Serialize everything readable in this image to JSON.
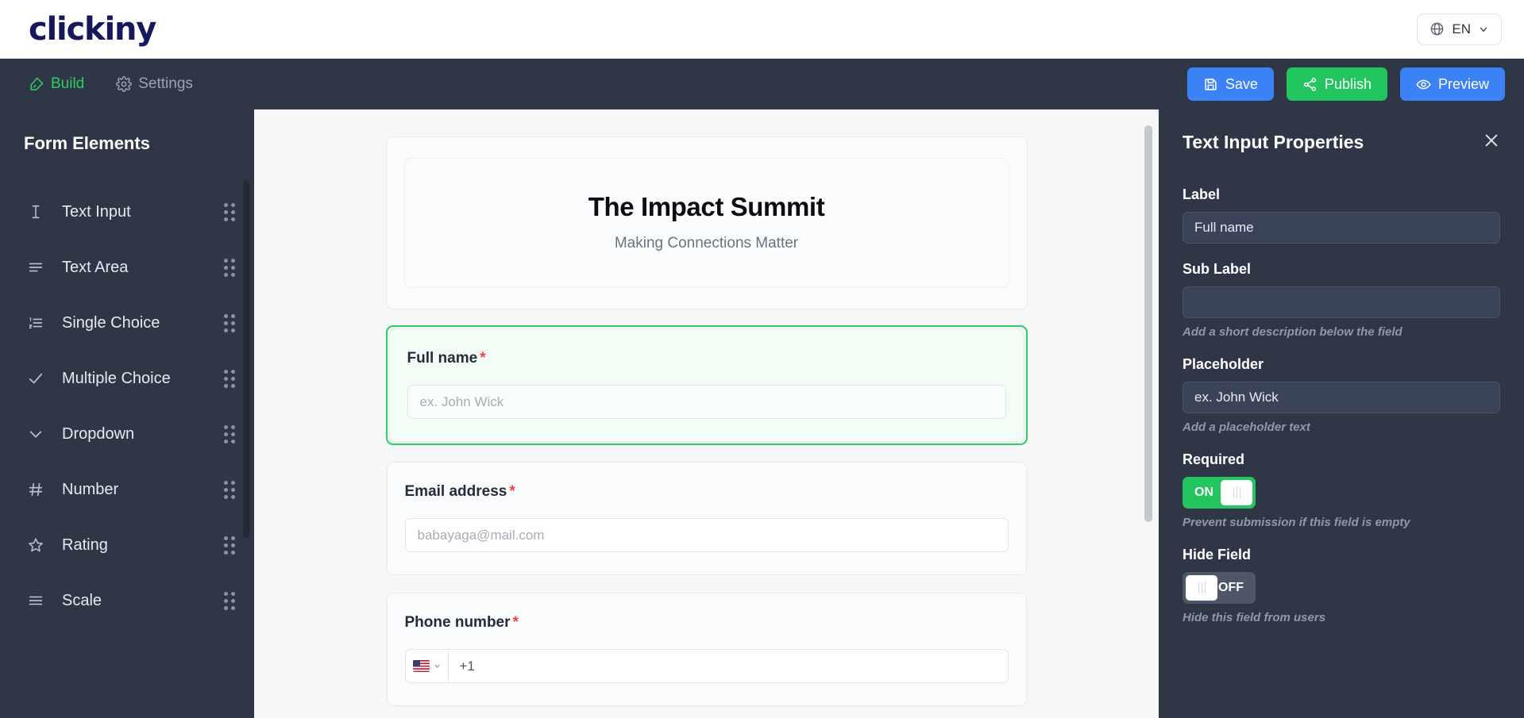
{
  "brand": {
    "logo_text": "clickiny"
  },
  "language": {
    "value": "EN",
    "globe_icon": "globe-icon",
    "chevron_icon": "chevron-down-icon"
  },
  "toolbar": {
    "tabs": [
      {
        "label": "Build",
        "icon": "pen-tool-icon",
        "active": true
      },
      {
        "label": "Settings",
        "icon": "gear-icon",
        "active": false
      }
    ],
    "buttons": [
      {
        "label": "Save",
        "icon": "save-floppy-icon",
        "color": "#3b82f6"
      },
      {
        "label": "Publish",
        "icon": "share-icon",
        "color": "#22c55e"
      },
      {
        "label": "Preview",
        "icon": "eye-icon",
        "color": "#3b82f6"
      }
    ]
  },
  "sidebar": {
    "title": "Form Elements",
    "items": [
      {
        "label": "Text Input",
        "icon": "text-cursor-icon"
      },
      {
        "label": "Text Area",
        "icon": "text-lines-icon"
      },
      {
        "label": "Single Choice",
        "icon": "ordered-list-icon"
      },
      {
        "label": "Multiple Choice",
        "icon": "check-icon"
      },
      {
        "label": "Dropdown",
        "icon": "chevron-down-icon"
      },
      {
        "label": "Number",
        "icon": "hash-icon"
      },
      {
        "label": "Rating",
        "icon": "star-icon"
      },
      {
        "label": "Scale",
        "icon": "sliders-lines-icon"
      }
    ]
  },
  "form": {
    "title": "The Impact Summit",
    "subtitle": "Making Connections Matter",
    "required_marker": "*",
    "fields": [
      {
        "label": "Full name",
        "required": true,
        "placeholder": "ex. John Wick",
        "selected": true
      },
      {
        "label": "Email address",
        "required": true,
        "placeholder": "babayaga@mail.com",
        "selected": false
      },
      {
        "label": "Phone number",
        "required": true,
        "country_code": "+1",
        "flag": "us-flag-icon",
        "selected": false
      }
    ]
  },
  "properties": {
    "title": "Text Input Properties",
    "close_icon": "close-icon",
    "label": {
      "title": "Label",
      "value": "Full name"
    },
    "sub_label": {
      "title": "Sub Label",
      "value": "",
      "hint": "Add a short description below the field"
    },
    "placeholder": {
      "title": "Placeholder",
      "value": "ex. John Wick",
      "hint": "Add a placeholder text"
    },
    "required": {
      "title": "Required",
      "state": "ON",
      "hint": "Prevent submission if this field is empty"
    },
    "hide_field": {
      "title": "Hide Field",
      "state": "OFF",
      "hint": "Hide this field from users"
    }
  },
  "colors": {
    "accent_green": "#22c55e",
    "accent_blue": "#3b82f6",
    "panel_dark": "#2f3746",
    "required_red": "#ef4444"
  }
}
